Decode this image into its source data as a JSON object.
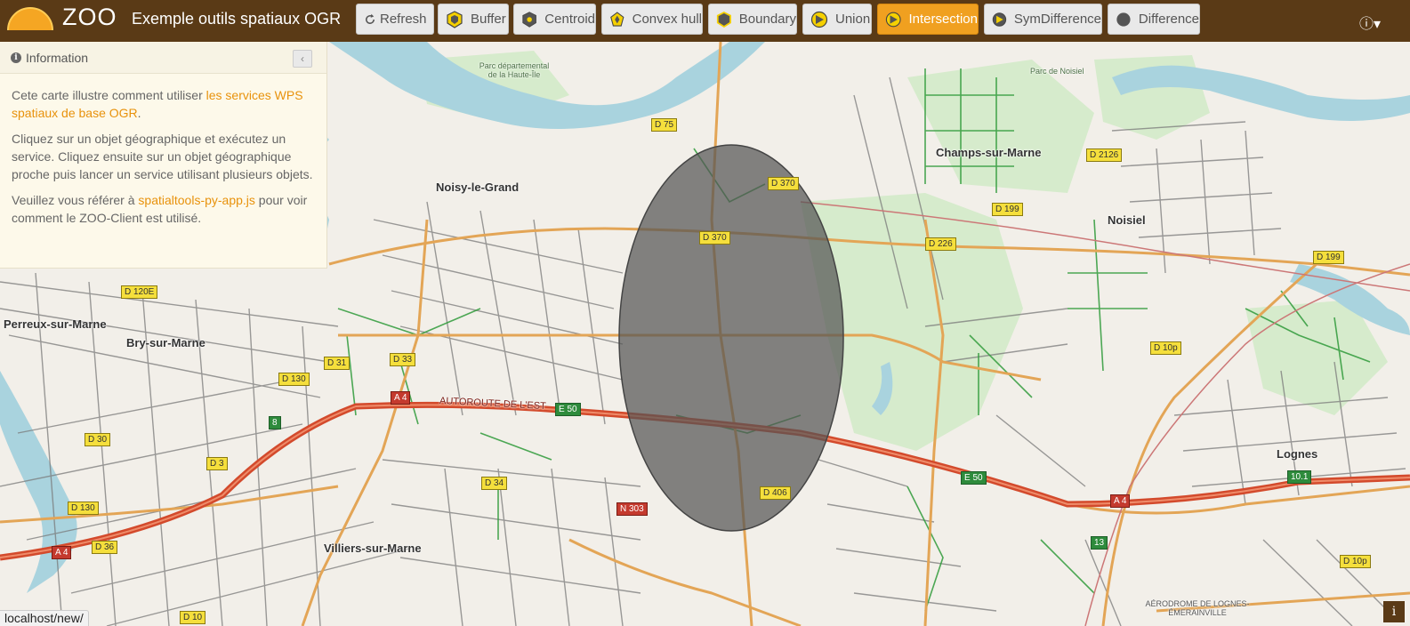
{
  "header": {
    "logo_text": "ZOO",
    "app_title": "Exemple outils spatiaux OGR",
    "buttons": [
      {
        "label": "Refresh",
        "icon": "refresh-icon"
      },
      {
        "label": "Buffer",
        "icon": "buffer-icon"
      },
      {
        "label": "Centroid",
        "icon": "centroid-icon"
      },
      {
        "label": "Convex hull",
        "icon": "convex-hull-icon"
      },
      {
        "label": "Boundary",
        "icon": "boundary-icon"
      },
      {
        "label": "Union",
        "icon": "union-icon"
      },
      {
        "label": "Intersection",
        "icon": "intersection-icon",
        "active": true
      },
      {
        "label": "SymDifference",
        "icon": "symdifference-icon"
      },
      {
        "label": "Difference",
        "icon": "difference-icon"
      }
    ],
    "info_icon": "info-icon"
  },
  "panel": {
    "title": "Information",
    "collapse_icon": "chevron-left-icon",
    "p1_before": "Cete carte illustre comment utiliser ",
    "p1_link": "les services WPS spatiaux de base OGR",
    "p1_after": ".",
    "p2": "Cliquez sur un objet géographique et exécutez un service. Cliquez ensuite sur un objet géographique proche puis lancer un service utilisant plusieurs objets.",
    "p3_before": "Veuillez vous référer à ",
    "p3_link": "spatialtools-py-app.js",
    "p3_after": " pour voir comment le ZOO-Client est utilisé."
  },
  "status_url": "localhost/new/",
  "map_info_label": "i",
  "map": {
    "places": [
      "Noisy-le-Grand",
      "Champs-sur-Marne",
      "Noisiel",
      "Perreux-sur-Marne",
      "Bry-sur-Marne",
      "Villiers-sur-Marne",
      "Lognes",
      "Parc départemental de la Haute-Île",
      "Parc de Noisiel",
      "AÉRODROME DE LOGNES-ÉMERAINVILLE"
    ],
    "roads": [
      "D 75",
      "D 370",
      "D 199",
      "D 226",
      "D 2126",
      "D 199",
      "D 120E",
      "D 33",
      "D 31",
      "D 130",
      "D 30",
      "D 3",
      "D 34",
      "D 130",
      "D 36",
      "D 10",
      "D 10p",
      "D 10p",
      "D 406",
      "D 370",
      "A 4",
      "E 50",
      "N 303",
      "A 4",
      "E 50",
      "A 4",
      "10.1",
      "13",
      "8"
    ],
    "motorway_label": "AUTOROUTE DE L'EST",
    "colors": {
      "land": "#f2efe9",
      "water": "#a9d3de",
      "park": "#cfe7c5",
      "motorway": "#e15b3a",
      "primary": "#f4b86a",
      "path": "#2f9a3a",
      "intersection": "#555555"
    }
  }
}
